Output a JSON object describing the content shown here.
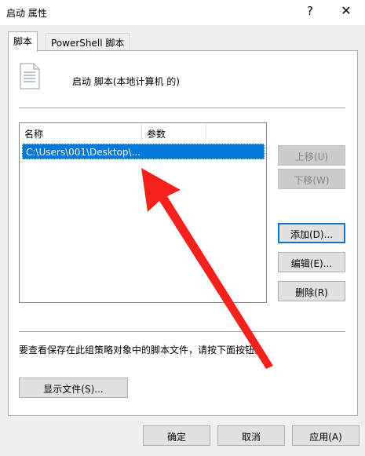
{
  "window": {
    "title": "启动 属性",
    "help_glyph": "?",
    "close_glyph": "✕"
  },
  "tabs": [
    {
      "label": "脚本",
      "active": true
    },
    {
      "label": "PowerShell 脚本",
      "active": false
    }
  ],
  "header": {
    "icon": "script-file-icon",
    "text": "启动 脚本(本地计算机 的)"
  },
  "list": {
    "columns": [
      "名称",
      "参数"
    ],
    "rows": [
      {
        "name": "C:\\Users\\001\\Desktop\\...",
        "params": "",
        "selected": true
      }
    ]
  },
  "side_buttons": {
    "move_up": "上移(U)",
    "move_down": "下移(W)",
    "add": "添加(D)...",
    "edit": "编辑(E)...",
    "remove": "删除(R)"
  },
  "info_text": "要查看保存在此组策略对象中的脚本文件，请按下面按钮。",
  "show_files_button": "显示文件(S)...",
  "footer": {
    "ok": "确定",
    "cancel": "取消",
    "apply": "应用(A)"
  },
  "colors": {
    "selection": "#0078d7",
    "annotation_arrow": "#f5221b"
  }
}
